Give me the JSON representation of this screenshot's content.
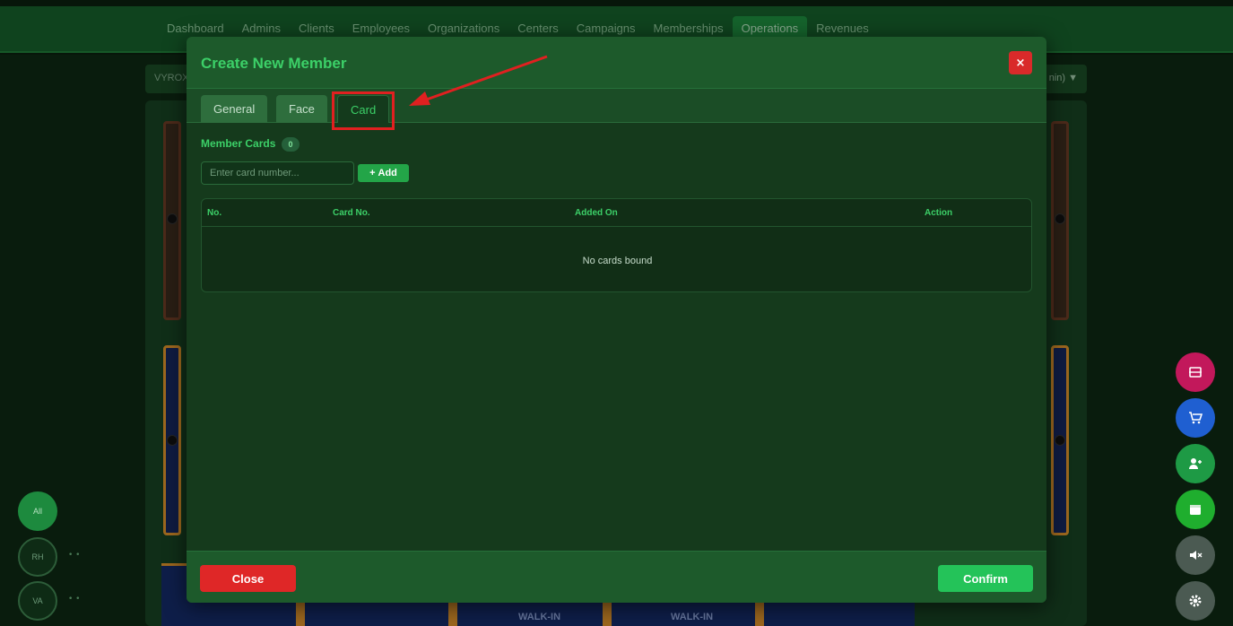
{
  "nav": {
    "items": [
      "Dashboard",
      "Admins",
      "Clients",
      "Employees",
      "Organizations",
      "Centers",
      "Campaigns",
      "Memberships",
      "Operations",
      "Revenues"
    ],
    "active_index": 8
  },
  "background": {
    "center_select": "VYROX",
    "role_select": "nin) ▼",
    "walkin_labels": [
      "WALK-IN",
      "WALK-IN"
    ],
    "left_filters": [
      "All",
      "RH",
      "VA"
    ]
  },
  "modal": {
    "title": "Create New Member",
    "close_x": "×",
    "tabs": [
      "General",
      "Face",
      "Card"
    ],
    "active_tab": "Card",
    "section_title": "Member Cards",
    "card_count": "0",
    "card_input_placeholder": "Enter card number...",
    "add_button_icon": "+",
    "add_button_label": "Add",
    "table": {
      "columns": [
        "No.",
        "Card No.",
        "Added On",
        "Action"
      ],
      "empty_message": "No cards bound"
    },
    "close_button_label": "Close",
    "confirm_button_label": "Confirm"
  },
  "fab_icons": [
    "barcode-icon",
    "cart-icon",
    "add-user-icon",
    "calendar-icon",
    "mute-icon",
    "gear-icon"
  ],
  "colors": {
    "accent": "#3cd068",
    "danger": "#df2727",
    "confirm": "#24c359",
    "annotation": "#e02020"
  }
}
